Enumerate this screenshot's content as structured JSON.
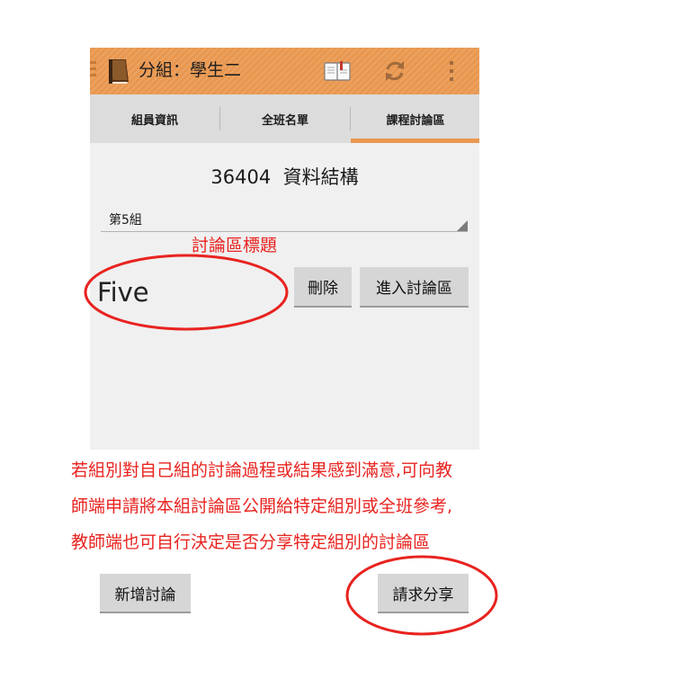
{
  "app": {
    "title": "分組：學生二",
    "icons": {
      "up": "menu-lines-icon",
      "logo": "book-logo-icon",
      "book": "open-book-icon",
      "refresh": "refresh-icon",
      "more": "overflow-menu-icon"
    },
    "accent": "#e9974f"
  },
  "tabs": [
    {
      "label": "組員資訊"
    },
    {
      "label": "全班名單"
    },
    {
      "label": "課程討論區",
      "selected": true
    }
  ],
  "course": {
    "title": "36404  資料結構"
  },
  "group_select": {
    "value": "第5組"
  },
  "topic": {
    "name": "Five",
    "delete_label": "刪除",
    "enter_label": "進入討論區"
  },
  "annotations": {
    "topic_label": "討論區標題",
    "note_lines": [
      "若組別對自己組的討論過程或結果感到滿意,可向教",
      "師端申請將本組討論區公開給特定組別或全班參考,",
      "教師端也可自行決定是否分享特定組別的討論區"
    ],
    "color": "#e8231f"
  },
  "footer": {
    "new_discussion_label": "新增討論",
    "share_request_label": "請求分享"
  }
}
